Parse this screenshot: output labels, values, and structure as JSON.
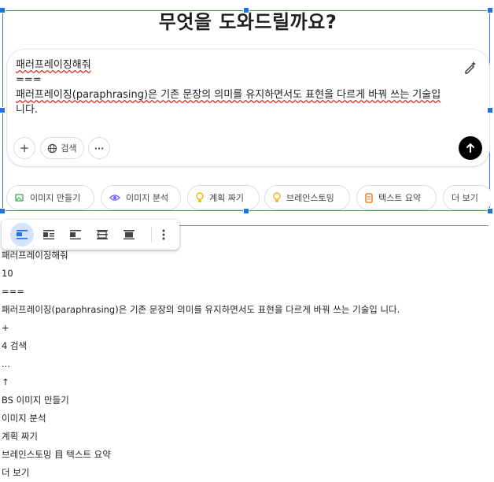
{
  "screen": {
    "title": "무엇을 도와드릴까요?",
    "prompt_lines": [
      "패러프레이징해줘",
      "===",
      "패러프레이징(paraphrasing)은 기존 문장의 의미를 유지하면서도 표현을 다르게 바꿔 쓰는 기술입",
      "니다."
    ],
    "icons": {
      "edit": "edit-sparkle-icon",
      "plus": "plus-icon",
      "globe": "globe-icon",
      "more": "more-dots-icon",
      "send": "arrow-up-icon"
    },
    "search_label": "검색",
    "plus_label": "+",
    "more_label": "···",
    "chips": [
      {
        "label": "이미지 만들기",
        "icon": "image-create-icon",
        "color": "#34a853"
      },
      {
        "label": "이미지 분석",
        "icon": "eye-icon",
        "color": "#7b61ff"
      },
      {
        "label": "계획 짜기",
        "icon": "lightbulb-icon",
        "color": "#f4b400"
      },
      {
        "label": "브레인스토밍",
        "icon": "lightbulb-icon",
        "color": "#f4b400"
      },
      {
        "label": "텍스트 요약",
        "icon": "document-icon",
        "color": "#e8710a"
      },
      {
        "label": "더 보기",
        "icon": "",
        "color": ""
      }
    ]
  },
  "image_toolbar": {
    "buttons": [
      "inline-icon",
      "wrap-text-icon",
      "break-text-icon",
      "behind-text-icon",
      "in-front-of-text-icon"
    ],
    "more_icon": "more-vertical-icon",
    "accent": "#1a73e8"
  },
  "document_lines": [
    "패러프레이징해줘",
    "10",
    "===",
    "패러프레이징(paraphrasing)은 기존 문장의 의미를 유지하면서도 표현을 다르게 바꿔 쓰는 기술입 니다.",
    "+",
    "4 검색",
    "...",
    "↑",
    "BS 이미지 만들기",
    "이미지 분석",
    "계획 짜기",
    "브레인스토밍 目 텍스트 요약",
    "더 보기"
  ]
}
